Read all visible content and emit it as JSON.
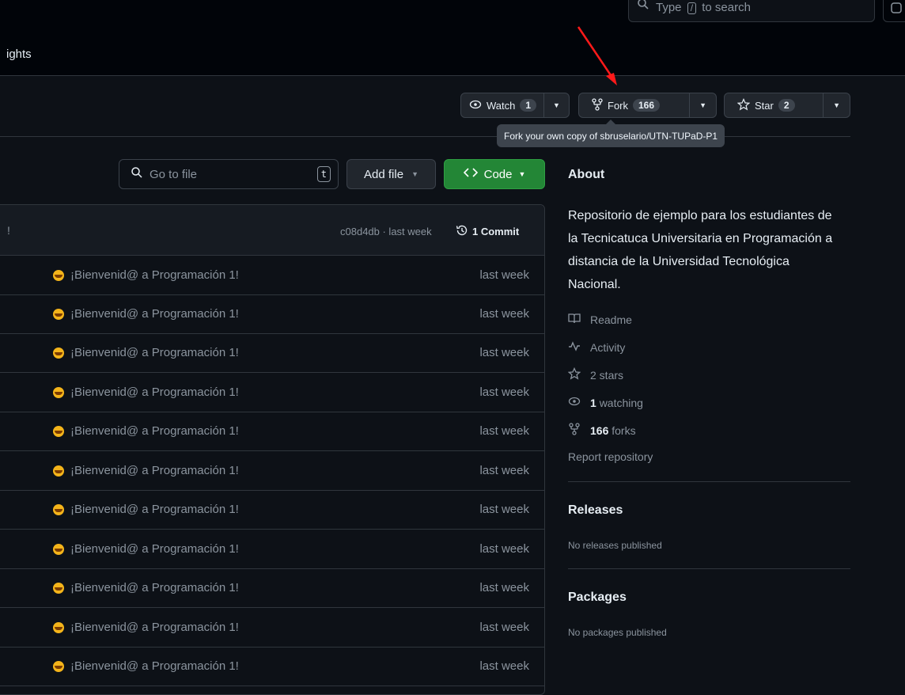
{
  "header": {
    "search_placeholder_pre": "Type",
    "search_key": "/",
    "search_placeholder_post": "to search",
    "nav_tail": "ights"
  },
  "actions": {
    "watch_label": "Watch",
    "watch_count": "1",
    "fork_label": "Fork",
    "fork_count": "166",
    "star_label": "Star",
    "star_count": "2"
  },
  "tooltip": "Fork your own copy of sbruselario/UTN-TUPaD-P1",
  "toolbar": {
    "goto_placeholder": "Go to file",
    "goto_key": "t",
    "add_file": "Add file",
    "code": "Code"
  },
  "commit_bar": {
    "message_tail": "!",
    "sha_time": "c08d4db · last week",
    "commits": "1 Commit"
  },
  "files": [
    {
      "message": "¡Bienvenid@ a Programación 1!",
      "when": "last week"
    },
    {
      "message": "¡Bienvenid@ a Programación 1!",
      "when": "last week"
    },
    {
      "message": "¡Bienvenid@ a Programación 1!",
      "when": "last week"
    },
    {
      "message": "¡Bienvenid@ a Programación 1!",
      "when": "last week"
    },
    {
      "message": "¡Bienvenid@ a Programación 1!",
      "when": "last week"
    },
    {
      "message": "¡Bienvenid@ a Programación 1!",
      "when": "last week"
    },
    {
      "message": "¡Bienvenid@ a Programación 1!",
      "when": "last week"
    },
    {
      "message": "¡Bienvenid@ a Programación 1!",
      "when": "last week"
    },
    {
      "message": "¡Bienvenid@ a Programación 1!",
      "when": "last week"
    },
    {
      "message": "¡Bienvenid@ a Programación 1!",
      "when": "last week"
    },
    {
      "message": "¡Bienvenid@ a Programación 1!",
      "when": "last week"
    }
  ],
  "about": {
    "title": "About",
    "description": "Repositorio de ejemplo para los estudiantes de la Tecnicatuca Universitaria en Programación a distancia de la Universidad Tecnológica Nacional.",
    "readme": "Readme",
    "activity": "Activity",
    "stars": "2 stars",
    "watching_count": "1",
    "watching_label": "watching",
    "forks_count": "166",
    "forks_label": "forks",
    "report": "Report repository"
  },
  "releases": {
    "title": "Releases",
    "note": "No releases published"
  },
  "packages": {
    "title": "Packages",
    "note": "No packages published"
  },
  "colors": {
    "accent_green": "#238636",
    "annotation_arrow": "#ff0000",
    "background": "#0d1117"
  }
}
